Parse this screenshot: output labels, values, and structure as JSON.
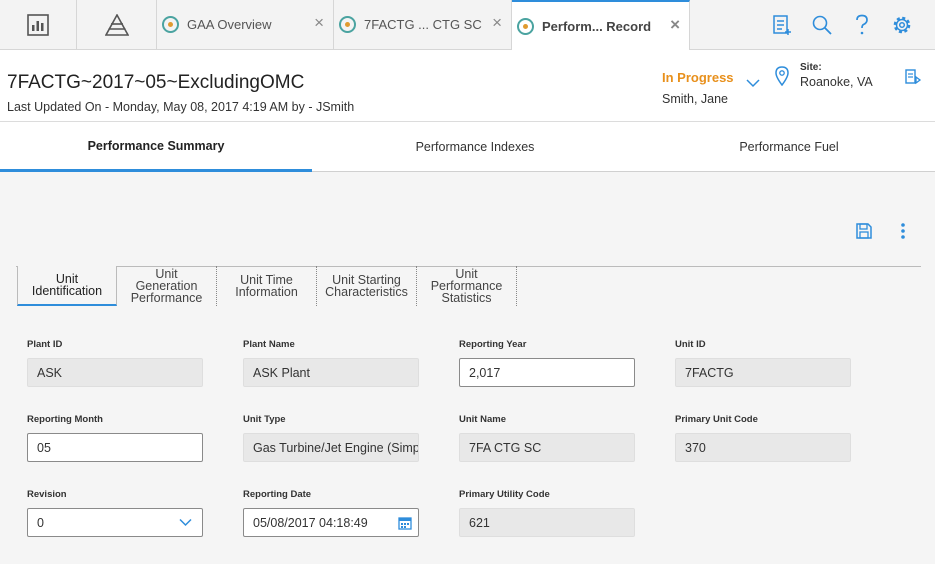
{
  "topbar": {
    "tabs": [
      {
        "label": "GAA Overview"
      },
      {
        "label": "7FACTG ... CTG SC"
      },
      {
        "label": "Perform... Record"
      }
    ],
    "close_glyph": "×"
  },
  "record": {
    "title": "7FACTG~2017~05~ExcludingOMC",
    "last_updated": "Last Updated On - Monday, May 08, 2017 4:19 AM by - JSmith",
    "state": "In Progress",
    "state_color": "#e8901c",
    "owner": "Smith, Jane",
    "site_label": "Site:",
    "site_value": "Roanoke, VA"
  },
  "section_tabs": [
    "Performance Summary",
    "Performance Indexes",
    "Performance Fuel"
  ],
  "sub_tabs": [
    {
      "l1": "Unit",
      "l2": "Identification",
      "l3": ""
    },
    {
      "l1": "Unit",
      "l2": "Generation",
      "l3": "Performance"
    },
    {
      "l1": "Unit Time",
      "l2": "Information",
      "l3": ""
    },
    {
      "l1": "Unit Starting",
      "l2": "Characteristics",
      "l3": ""
    },
    {
      "l1": "Unit",
      "l2": "Performance",
      "l3": "Statistics"
    }
  ],
  "fields": {
    "plant_id": {
      "label": "Plant ID",
      "value": "ASK"
    },
    "plant_name": {
      "label": "Plant Name",
      "value": "ASK Plant"
    },
    "reporting_year": {
      "label": "Reporting Year",
      "value": "2,017"
    },
    "unit_id": {
      "label": "Unit ID",
      "value": "7FACTG"
    },
    "reporting_month": {
      "label": "Reporting Month",
      "value": "05"
    },
    "unit_type": {
      "label": "Unit Type",
      "value": "Gas Turbine/Jet Engine (Simp"
    },
    "unit_name": {
      "label": "Unit Name",
      "value": "7FA CTG SC"
    },
    "primary_unit_code": {
      "label": "Primary Unit Code",
      "value": "370"
    },
    "revision": {
      "label": "Revision",
      "value": "0"
    },
    "reporting_date": {
      "label": "Reporting Date",
      "value": "05/08/2017 04:18:49"
    },
    "primary_utility_code": {
      "label": "Primary Utility Code",
      "value": "621"
    }
  },
  "colors": {
    "accent": "#2e8ddb",
    "icon": "#2e8ddb"
  },
  "icons": [
    "dashboard-icon",
    "asset-hierarchy-icon",
    "record-icon",
    "queue-icon",
    "search-icon",
    "help-icon",
    "settings-icon",
    "chevron-down-icon",
    "location-pin-icon",
    "site-action-icon",
    "save-icon",
    "more-options-icon",
    "calendar-icon"
  ]
}
